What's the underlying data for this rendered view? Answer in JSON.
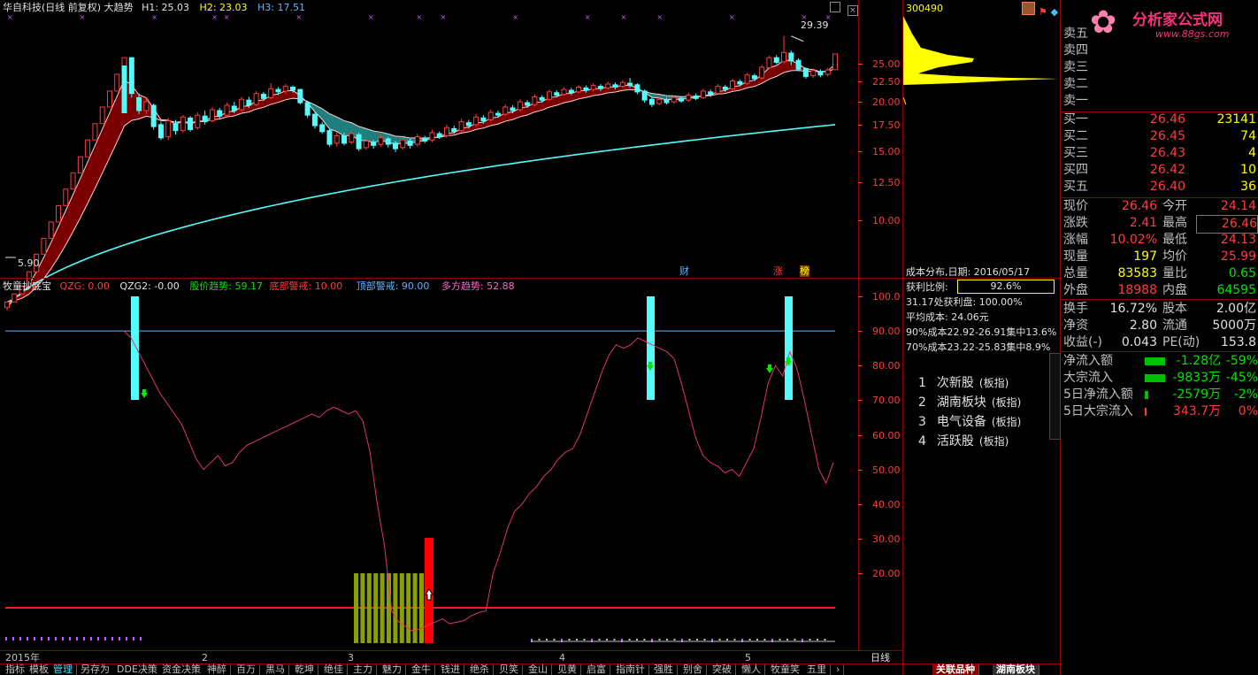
{
  "header": {
    "title": "华自科技(日线 前复权) 大趋势",
    "h1": "H1: 25.03",
    "h2": "H2: 23.03",
    "h3": "H3: 17.51",
    "high_marker": "29.39",
    "low_marker": "5.90"
  },
  "right_header": {
    "stock_code": "300490",
    "logo_text": "分析家公式网",
    "logo_url": "www.88gs.com"
  },
  "price_axis": [
    "25.00",
    "22.50",
    "20.00",
    "17.50",
    "15.00",
    "12.50",
    "10.00"
  ],
  "indicator_axis": [
    "100.0",
    "90.00",
    "80.00",
    "70.00",
    "60.00",
    "50.00",
    "40.00",
    "30.00",
    "20.00"
  ],
  "event_badges": {
    "cai": "财",
    "zhang": "涨",
    "bang": "榜"
  },
  "indicator_header": {
    "name": "牧童抄底宝",
    "qzg": "QZG: 0.00",
    "qzg2": "QZG2: -0.00",
    "price_trend": "股价趋势: 59.17",
    "bottom_alert": "底部警戒: 10.00",
    "top_alert": "顶部警戒: 90.00",
    "bull_trend": "多方趋势: 52.88"
  },
  "time_axis": {
    "labels": [
      "2015年",
      "2",
      "3",
      "4",
      "5"
    ],
    "period": "日线"
  },
  "cost_panel": {
    "title": "成本分布,日期: 2016/05/17",
    "profit_label": "获利比例:",
    "profit_value": "92.6%",
    "line1": "31.17处获利盘: 100.00%",
    "line2": "平均成本: 24.06元",
    "line3": "90%成本22.92-26.91集中13.6%",
    "line4": "70%成本23.22-25.83集中8.9%"
  },
  "sectors": [
    {
      "num": "1",
      "name": "次新股",
      "tag": "(板指)"
    },
    {
      "num": "2",
      "name": "湖南板块",
      "tag": "(板指)"
    },
    {
      "num": "3",
      "name": "电气设备",
      "tag": "(板指)"
    },
    {
      "num": "4",
      "name": "活跃股",
      "tag": "(板指)"
    }
  ],
  "order_book": {
    "sells": [
      {
        "name": "卖五",
        "price": "",
        "vol": ""
      },
      {
        "name": "卖四",
        "price": "",
        "vol": ""
      },
      {
        "name": "卖三",
        "price": "",
        "vol": ""
      },
      {
        "name": "卖二",
        "price": "",
        "vol": ""
      },
      {
        "name": "卖一",
        "price": "",
        "vol": ""
      }
    ],
    "buys": [
      {
        "name": "买一",
        "price": "26.46",
        "vol": "23141"
      },
      {
        "name": "买二",
        "price": "26.45",
        "vol": "74"
      },
      {
        "name": "买三",
        "price": "26.43",
        "vol": "4"
      },
      {
        "name": "买四",
        "price": "26.42",
        "vol": "10"
      },
      {
        "name": "买五",
        "price": "26.40",
        "vol": "36"
      }
    ]
  },
  "stats": [
    {
      "l1": "现价",
      "v1": "26.46",
      "l2": "今开",
      "v2": "24.14"
    },
    {
      "l1": "涨跌",
      "v1": "2.41",
      "l2": "最高",
      "v2": "26.46"
    },
    {
      "l1": "涨幅",
      "v1": "10.02%",
      "l2": "最低",
      "v2": "24.13"
    },
    {
      "l1": "现量",
      "v1": "197",
      "l2": "均价",
      "v2": "25.99"
    },
    {
      "l1": "总量",
      "v1": "83583",
      "l2": "量比",
      "v2": "0.65"
    },
    {
      "l1": "外盘",
      "v1": "18988",
      "l2": "内盘",
      "v2": "64595"
    }
  ],
  "stats2": [
    {
      "l1": "换手",
      "v1": "16.72%",
      "l2": "股本",
      "v2": "2.00亿"
    },
    {
      "l1": "净资",
      "v1": "2.80",
      "l2": "流通",
      "v2": "5000万"
    },
    {
      "l1": "收益(-)",
      "v1": "0.043",
      "l2": "PE(动)",
      "v2": "153.8"
    }
  ],
  "flows": [
    {
      "label": "净流入额",
      "value": "-1.28亿",
      "pct": "-59%",
      "bar": 0.45
    },
    {
      "label": "大宗流入",
      "value": "-9833万",
      "pct": "-45%",
      "bar": 0.45
    },
    {
      "label": "5日净流入额",
      "value": "-2579万",
      "pct": "-2%",
      "bar": 0.08
    },
    {
      "label": "5日大宗流入",
      "value": "343.7万",
      "pct": "0%",
      "bar": 0.03
    }
  ],
  "bottom_tabs": [
    "指标",
    "模板",
    "管理",
    "另存为",
    "DDE决策",
    "资金决策",
    "神醉",
    "百万",
    "黑马",
    "乾坤",
    "绝佳",
    "主力",
    "魅力",
    "金牛",
    "钱进",
    "绝杀",
    "贝笑",
    "金山",
    "见黄",
    "启富",
    "指南针",
    "强胜",
    "别舍",
    "突破",
    "懒人",
    "牧童笑",
    "五里"
  ],
  "bottom_right_tabs": [
    "关联品种",
    "湖南板块"
  ],
  "candles": [
    [
      6.0,
      6.2,
      5.9,
      6.2
    ],
    [
      6.2,
      6.5,
      6.2,
      6.5
    ],
    [
      6.5,
      6.8,
      6.5,
      6.8
    ],
    [
      6.8,
      7.4,
      6.8,
      7.4
    ],
    [
      7.4,
      8.2,
      7.4,
      8.2
    ],
    [
      8.2,
      9.0,
      8.2,
      9.0
    ],
    [
      9.0,
      9.9,
      9.0,
      9.9
    ],
    [
      9.9,
      10.9,
      9.9,
      10.9
    ],
    [
      10.9,
      12.0,
      10.9,
      12.0
    ],
    [
      12.0,
      13.2,
      12.0,
      13.2
    ],
    [
      13.2,
      14.5,
      13.2,
      14.5
    ],
    [
      14.5,
      16.0,
      14.5,
      16.0
    ],
    [
      16.0,
      17.6,
      16.0,
      17.6
    ],
    [
      17.6,
      19.4,
      17.6,
      19.4
    ],
    [
      19.4,
      21.3,
      19.4,
      21.3
    ],
    [
      21.3,
      23.5,
      21.3,
      23.5
    ],
    [
      23.5,
      25.9,
      23.5,
      25.9
    ],
    [
      25.9,
      21.0,
      20.5,
      26.0
    ],
    [
      20.5,
      19.0,
      18.6,
      21.0
    ],
    [
      19.0,
      20.0,
      18.6,
      20.5
    ],
    [
      19.6,
      17.3,
      17.0,
      19.8
    ],
    [
      17.5,
      16.2,
      16.0,
      17.8
    ],
    [
      16.3,
      17.9,
      16.0,
      18.2
    ],
    [
      17.6,
      16.9,
      16.5,
      18.0
    ],
    [
      16.9,
      18.3,
      16.7,
      18.5
    ],
    [
      18.2,
      17.0,
      16.8,
      18.4
    ],
    [
      17.2,
      18.5,
      17.0,
      18.8
    ],
    [
      18.4,
      17.8,
      17.5,
      19.0
    ],
    [
      17.9,
      19.1,
      17.7,
      19.4
    ],
    [
      19.0,
      18.4,
      18.1,
      19.3
    ],
    [
      18.5,
      19.6,
      18.3,
      19.9
    ],
    [
      19.5,
      19.0,
      18.7,
      20.0
    ],
    [
      19.1,
      20.3,
      18.9,
      20.6
    ],
    [
      20.2,
      19.6,
      19.3,
      20.6
    ],
    [
      19.7,
      21.0,
      19.5,
      21.3
    ],
    [
      20.9,
      20.4,
      20.1,
      21.2
    ],
    [
      20.5,
      21.6,
      20.3,
      22.3
    ],
    [
      21.5,
      21.2,
      20.8,
      21.8
    ],
    [
      21.3,
      21.9,
      21.0,
      22.2
    ],
    [
      21.8,
      21.4,
      21.1,
      22.0
    ],
    [
      21.5,
      19.9,
      19.7,
      21.6
    ],
    [
      19.9,
      18.5,
      18.2,
      20.1
    ],
    [
      18.6,
      17.4,
      17.1,
      18.8
    ],
    [
      17.5,
      16.8,
      16.6,
      17.8
    ],
    [
      16.9,
      15.6,
      15.4,
      17.1
    ],
    [
      15.7,
      16.4,
      15.4,
      16.7
    ],
    [
      16.4,
      15.7,
      15.5,
      16.7
    ],
    [
      15.8,
      16.6,
      15.6,
      16.9
    ],
    [
      16.5,
      15.2,
      15.0,
      16.7
    ],
    [
      15.3,
      15.9,
      15.1,
      16.1
    ],
    [
      15.8,
      15.5,
      15.2,
      16.0
    ],
    [
      15.6,
      16.2,
      15.4,
      16.5
    ],
    [
      16.1,
      15.6,
      15.3,
      16.3
    ],
    [
      15.7,
      15.2,
      14.9,
      15.9
    ],
    [
      15.3,
      16.0,
      15.1,
      16.2
    ],
    [
      15.9,
      15.5,
      15.2,
      16.1
    ],
    [
      15.6,
      16.3,
      15.4,
      16.6
    ],
    [
      16.2,
      15.9,
      15.7,
      16.4
    ],
    [
      16.0,
      16.7,
      15.8,
      17.0
    ],
    [
      16.6,
      16.3,
      16.1,
      16.8
    ],
    [
      16.4,
      17.2,
      16.2,
      17.5
    ],
    [
      17.1,
      16.8,
      16.6,
      17.4
    ],
    [
      16.9,
      17.8,
      16.7,
      18.1
    ],
    [
      17.7,
      17.4,
      17.1,
      18.0
    ],
    [
      17.5,
      18.3,
      17.3,
      18.6
    ],
    [
      18.2,
      17.9,
      17.6,
      18.5
    ],
    [
      18.0,
      18.8,
      17.8,
      19.1
    ],
    [
      18.7,
      18.5,
      18.2,
      19.0
    ],
    [
      18.6,
      19.4,
      18.4,
      19.7
    ],
    [
      19.3,
      19.0,
      18.7,
      19.6
    ],
    [
      19.1,
      20.0,
      18.9,
      20.3
    ],
    [
      19.9,
      19.6,
      19.3,
      20.2
    ],
    [
      19.7,
      20.6,
      19.5,
      20.9
    ],
    [
      20.5,
      20.2,
      19.9,
      20.8
    ],
    [
      20.3,
      21.2,
      20.1,
      21.5
    ],
    [
      21.1,
      20.8,
      20.5,
      21.4
    ],
    [
      20.9,
      21.5,
      20.7,
      21.8
    ],
    [
      21.4,
      21.1,
      20.8,
      21.7
    ],
    [
      21.2,
      21.8,
      21.0,
      22.1
    ],
    [
      21.7,
      21.4,
      21.1,
      22.0
    ],
    [
      21.5,
      22.0,
      21.3,
      22.3
    ],
    [
      21.9,
      21.6,
      21.3,
      22.2
    ],
    [
      21.7,
      22.2,
      21.5,
      22.5
    ],
    [
      22.1,
      21.8,
      21.5,
      22.4
    ],
    [
      21.9,
      22.4,
      21.7,
      22.7
    ],
    [
      22.3,
      22.0,
      21.7,
      23.0
    ],
    [
      22.1,
      21.2,
      20.9,
      22.3
    ],
    [
      21.3,
      20.2,
      19.9,
      21.5
    ],
    [
      20.3,
      19.7,
      19.4,
      20.5
    ],
    [
      19.8,
      20.3,
      19.6,
      20.6
    ],
    [
      20.2,
      19.9,
      19.7,
      20.5
    ],
    [
      20.0,
      20.5,
      19.8,
      20.8
    ],
    [
      20.4,
      20.1,
      19.9,
      20.7
    ],
    [
      20.2,
      20.8,
      20.0,
      21.1
    ],
    [
      20.7,
      20.4,
      20.2,
      21.0
    ],
    [
      20.5,
      21.3,
      20.3,
      21.6
    ],
    [
      21.2,
      20.9,
      20.6,
      21.5
    ],
    [
      21.0,
      21.9,
      20.8,
      22.2
    ],
    [
      21.8,
      21.5,
      21.2,
      22.1
    ],
    [
      21.6,
      22.6,
      21.4,
      22.9
    ],
    [
      22.5,
      22.2,
      21.9,
      22.8
    ],
    [
      22.3,
      23.4,
      22.1,
      23.7
    ],
    [
      23.3,
      22.9,
      22.6,
      23.6
    ],
    [
      23.0,
      24.5,
      22.8,
      24.8
    ],
    [
      24.4,
      25.9,
      24.2,
      26.2
    ],
    [
      25.9,
      25.2,
      24.9,
      26.3
    ],
    [
      25.3,
      26.7,
      25.1,
      29.39
    ],
    [
      26.6,
      25.4,
      24.8,
      27.0
    ],
    [
      25.5,
      24.2,
      23.9,
      25.8
    ],
    [
      24.3,
      23.2,
      22.9,
      24.5
    ],
    [
      23.3,
      24.0,
      23.0,
      24.3
    ],
    [
      23.9,
      23.4,
      23.1,
      24.2
    ],
    [
      23.5,
      24.1,
      23.2,
      24.4
    ],
    [
      24.14,
      26.46,
      24.13,
      26.46
    ]
  ],
  "osc": [
    90,
    88,
    84,
    80,
    76,
    72,
    69,
    66,
    63,
    58,
    53,
    50,
    52,
    54,
    51,
    52,
    55,
    57,
    58,
    59,
    60,
    61,
    62,
    63,
    64,
    65,
    66,
    65,
    67,
    68,
    67,
    66,
    67,
    64,
    55,
    40,
    28,
    18,
    11,
    8,
    5,
    7,
    9,
    11,
    13,
    10,
    11,
    12,
    15,
    17,
    18,
    20,
    26,
    33,
    38,
    40,
    43,
    45,
    48,
    50,
    53,
    55,
    56,
    60,
    66,
    72,
    78,
    83,
    86,
    85,
    86,
    88,
    87,
    86,
    85,
    84,
    82,
    75,
    67,
    59,
    54,
    52,
    51,
    49,
    50,
    48,
    52,
    56,
    65,
    75,
    80,
    77,
    84,
    79,
    70,
    60,
    50,
    46,
    52
  ],
  "colors": {
    "up": "#ff3c3c",
    "down": "#54fcfc",
    "band_red": "#7a0000",
    "band_teal": "#1f7f7f",
    "ma": "#54fcfc",
    "osc": "#e0356b",
    "top": "#5fb4ff",
    "bottom": "#ff1a1a",
    "purple": "#c060ff"
  }
}
